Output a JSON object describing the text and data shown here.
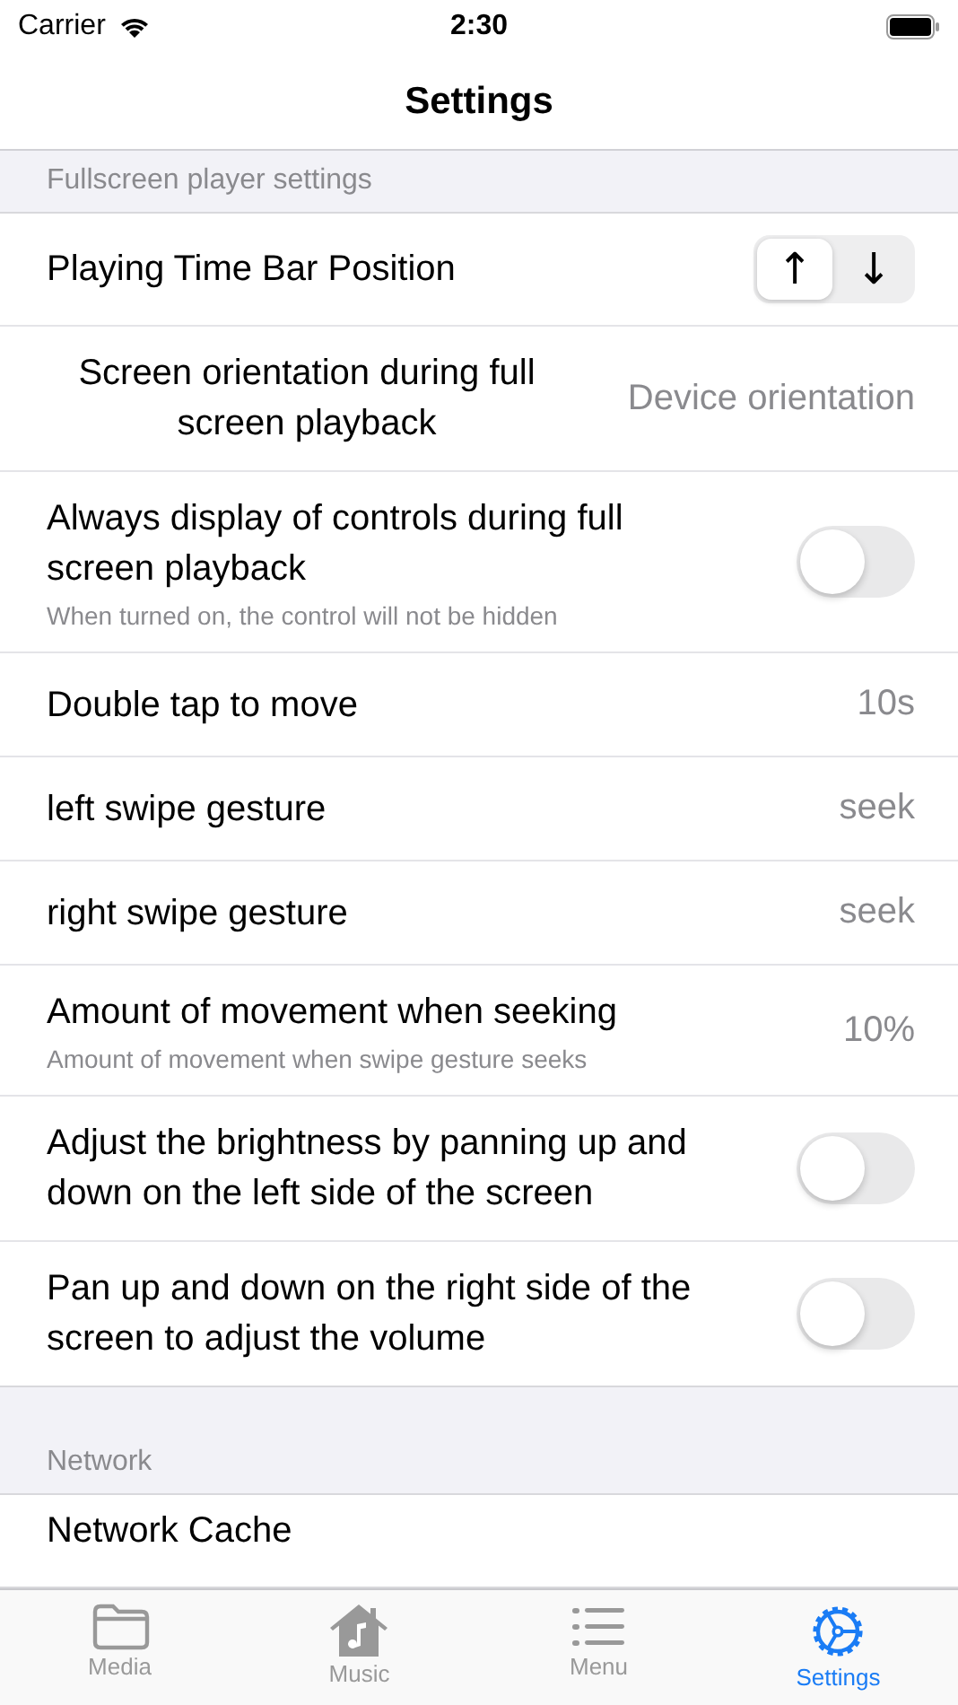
{
  "status_bar": {
    "carrier": "Carrier",
    "time": "2:30"
  },
  "nav": {
    "title": "Settings"
  },
  "sections": [
    {
      "header": "Fullscreen player settings",
      "rows": [
        {
          "kind": "segmented",
          "label": "Playing Time Bar Position",
          "segments": [
            {
              "glyph": "↑",
              "selected": true
            },
            {
              "glyph": "↓",
              "selected": false
            }
          ]
        },
        {
          "kind": "value",
          "label": "Screen orientation during full screen playback",
          "value": "Device orientation",
          "centered": true
        },
        {
          "kind": "toggle",
          "label": "Always display of controls during full screen playback",
          "subtitle": "When turned on, the control will not be hidden",
          "on": false
        },
        {
          "kind": "value",
          "label": "Double tap to move",
          "value": "10s"
        },
        {
          "kind": "value",
          "label": "left swipe gesture",
          "value": "seek"
        },
        {
          "kind": "value",
          "label": "right swipe gesture",
          "value": "seek"
        },
        {
          "kind": "value",
          "label": "Amount of movement when seeking",
          "subtitle": "Amount of movement when swipe gesture seeks",
          "value": "10%"
        },
        {
          "kind": "toggle",
          "label": "Adjust the brightness by panning up and down on the left side of the screen",
          "on": false
        },
        {
          "kind": "toggle",
          "label": "Pan up and down on the right side of the screen to adjust the volume",
          "on": false
        }
      ]
    },
    {
      "header": "Network",
      "rows": [
        {
          "kind": "partial",
          "label": "Network Cache"
        }
      ]
    }
  ],
  "tab_bar": [
    {
      "kind": "folder",
      "label": "Media",
      "selected": false
    },
    {
      "kind": "music",
      "label": "Music",
      "selected": false
    },
    {
      "kind": "list",
      "label": "Menu",
      "selected": false
    },
    {
      "kind": "gear",
      "label": "Settings",
      "selected": true
    }
  ]
}
